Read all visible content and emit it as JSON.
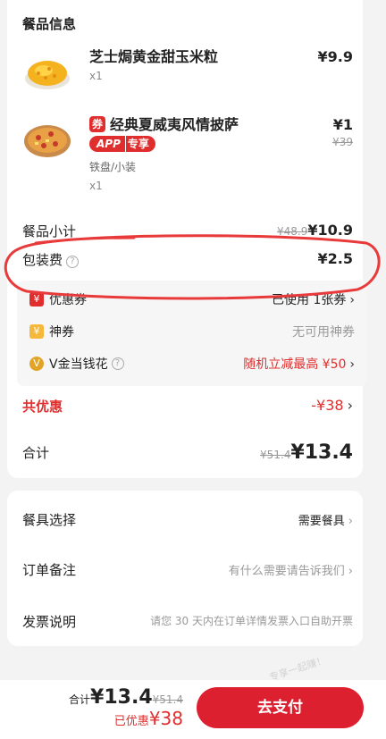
{
  "order": {
    "section_title": "餐品信息",
    "items": [
      {
        "name": "芝士焗黄金甜玉米粒",
        "qty": "x1",
        "price": "¥9.9",
        "image": "corn-dish-image"
      },
      {
        "coupon_icon": "券",
        "name": "经典夏威夷风情披萨",
        "badge_app": "APP",
        "badge_exclusive": "专享",
        "spec": "铁盘/小装",
        "qty": "x1",
        "price": "¥1",
        "orig_price": "¥39",
        "image": "pizza-image"
      }
    ],
    "subtotal_label": "餐品小计",
    "subtotal_orig": "¥48.9",
    "subtotal_value": "¥10.9",
    "packing_label": "包装费",
    "packing_value": "¥2.5",
    "discounts": [
      {
        "icon": "¥",
        "label": "优惠券",
        "value": "已使用 1张券"
      },
      {
        "icon": "¥",
        "label": "神券",
        "value": "无可用神券"
      },
      {
        "icon": "V",
        "label": "V金当钱花",
        "value": "随机立减最高 ¥50"
      }
    ],
    "total_discount_label": "共优惠",
    "total_discount_value": "-¥38",
    "total_label": "合计",
    "total_orig": "¥51.4",
    "total_value": "¥13.4"
  },
  "extra": {
    "rows": [
      {
        "label": "餐具选择",
        "value": "需要餐具"
      },
      {
        "label": "订单备注",
        "value": "有什么需要请告诉我们"
      },
      {
        "label": "发票说明",
        "value": "请您 30 天内在订单详情发票入口自助开票"
      }
    ]
  },
  "bottom": {
    "total_prefix": "合计",
    "total_value": "¥13.4",
    "total_orig": "¥51.4",
    "saved_prefix": "已优惠",
    "saved_value": "¥38",
    "pay_label": "去支付",
    "watermark": "专享一起赚！"
  },
  "colors": {
    "accent": "#dd2030",
    "annotation": "#e83a3a"
  }
}
